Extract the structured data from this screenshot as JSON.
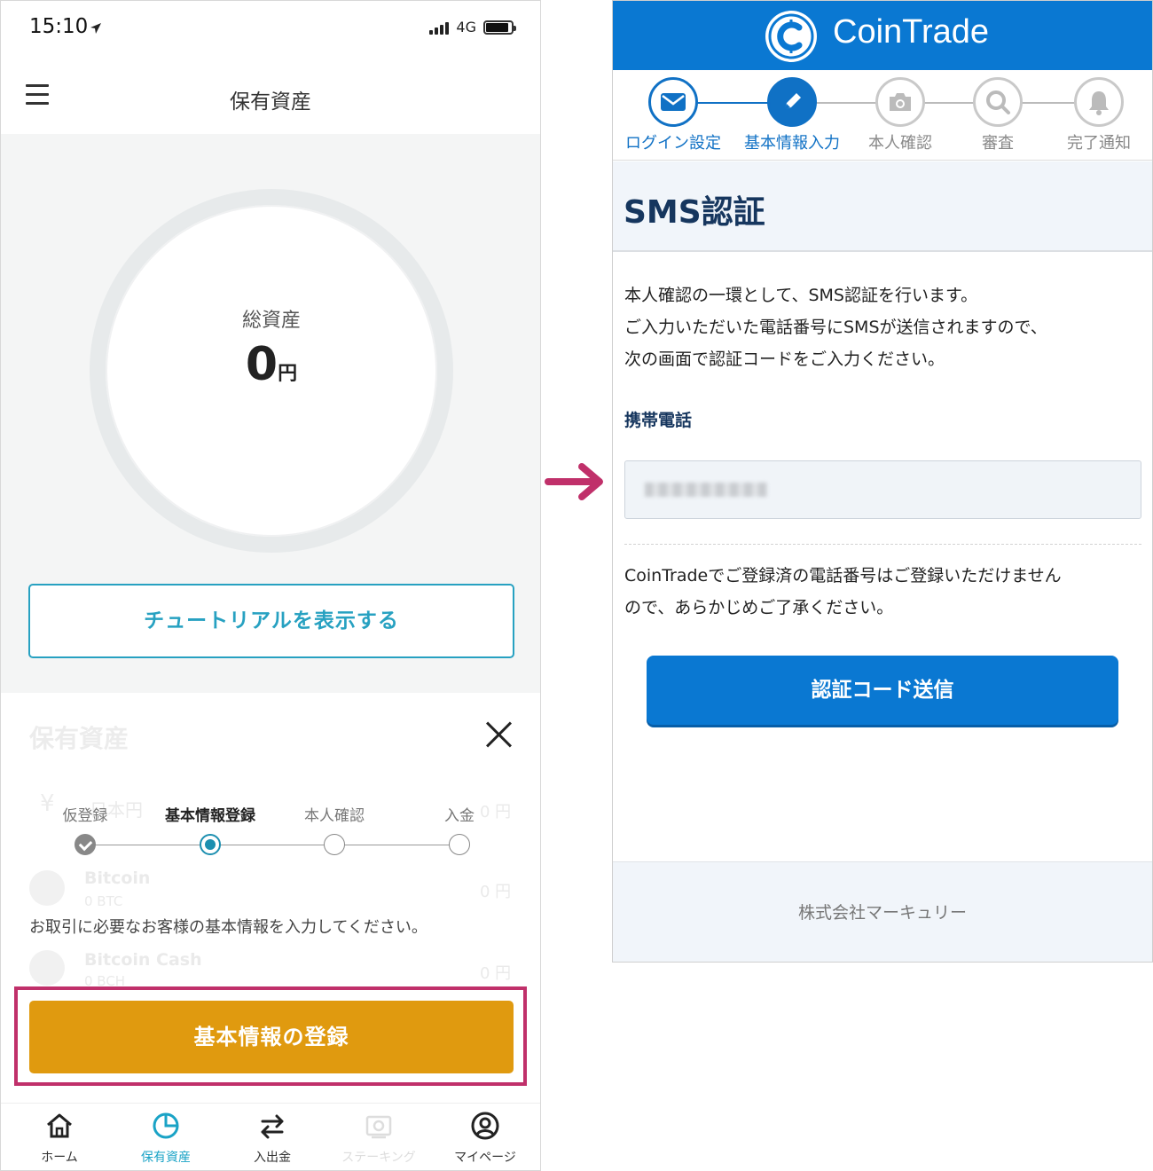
{
  "left_phone": {
    "status": {
      "time": "15:10",
      "network": "4G",
      "battery_level": 0.9
    },
    "nav": {
      "title": "保有資産"
    },
    "total_assets": {
      "label": "総資産",
      "value": "0",
      "unit": "円"
    },
    "tutorial_button": "チュートリアルを表示する",
    "sheet": {
      "background_title": "保有資産",
      "background_rows": [
        {
          "name": "日本円",
          "value": "0 円"
        },
        {
          "name": "Bitcoin",
          "sub": "0 BTC",
          "value": "0 円"
        },
        {
          "name": "Bitcoin Cash",
          "sub": "0 BCH",
          "value": "0 円"
        }
      ],
      "steps": [
        {
          "label": "仮登録",
          "state": "done"
        },
        {
          "label": "基本情報登録",
          "state": "current"
        },
        {
          "label": "本人確認",
          "state": "todo"
        },
        {
          "label": "入金",
          "state": "todo"
        }
      ],
      "description": "お取引に必要なお客様の基本情報を入力してください。",
      "register_button": "基本情報の登録"
    },
    "tabs": [
      {
        "label": "ホーム",
        "icon": "home-icon",
        "state": "normal"
      },
      {
        "label": "保有資産",
        "icon": "pie-chart-icon",
        "state": "active"
      },
      {
        "label": "入出金",
        "icon": "transfer-icon",
        "state": "normal"
      },
      {
        "label": "ステーキング",
        "icon": "staking-icon",
        "state": "disabled"
      },
      {
        "label": "マイページ",
        "icon": "user-icon",
        "state": "normal"
      }
    ]
  },
  "right_panel": {
    "brand": "CoinTrade",
    "steps": [
      {
        "label": "ログイン設定",
        "icon": "mail-icon",
        "state": "done"
      },
      {
        "label": "基本情報入力",
        "icon": "pencil-icon",
        "state": "current"
      },
      {
        "label": "本人確認",
        "icon": "camera-icon",
        "state": "todo"
      },
      {
        "label": "審査",
        "icon": "search-icon",
        "state": "todo"
      },
      {
        "label": "完了通知",
        "icon": "bell-icon",
        "state": "todo"
      }
    ],
    "heading": "SMS認証",
    "intro_lines": [
      "本人確認の一環として、SMS認証を行います。",
      "ご入力いただいた電話番号にSMSが送信されますので、",
      "次の画面で認証コードをご入力ください。"
    ],
    "phone_label": "携帯電話",
    "note_lines": [
      "CoinTradeでご登録済の電話番号はご登録いただけません",
      "ので、あらかじめご了承ください。"
    ],
    "send_button": "認証コード送信",
    "footer": "株式会社マーキュリー"
  },
  "colors": {
    "accent_teal": "#27a1c1",
    "register_orange": "#e09a0f",
    "highlight_magenta": "#c0306a",
    "brand_blue": "#0a78d2",
    "heading_navy": "#16365e"
  }
}
